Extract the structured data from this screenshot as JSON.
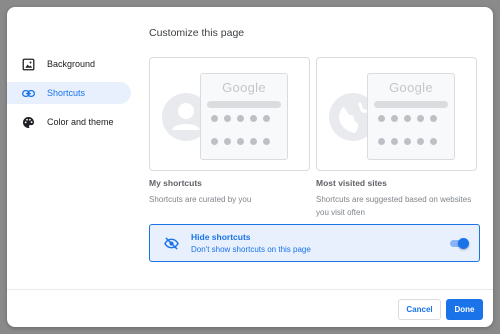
{
  "dialog": {
    "title": "Customize this page"
  },
  "sidebar": {
    "items": [
      {
        "label": "Background",
        "icon": "image-icon"
      },
      {
        "label": "Shortcuts",
        "icon": "link-icon",
        "active": true
      },
      {
        "label": "Color and theme",
        "icon": "palette-icon"
      }
    ]
  },
  "cards": [
    {
      "preview_logo": "Google",
      "title": "My shortcuts",
      "description": "Shortcuts are curated by you"
    },
    {
      "preview_logo": "Google",
      "title": "Most visited sites",
      "description": "Shortcuts are suggested based on websites you visit often"
    }
  ],
  "hide_shortcuts": {
    "title": "Hide shortcuts",
    "subtitle": "Don't show shortcuts on this page",
    "icon": "eye-off-icon",
    "enabled": true
  },
  "footer": {
    "cancel_label": "Cancel",
    "done_label": "Done"
  },
  "colors": {
    "accent": "#1a73e8",
    "selected_bg": "#e8f0fe",
    "backdrop": "#8a8a8a"
  }
}
